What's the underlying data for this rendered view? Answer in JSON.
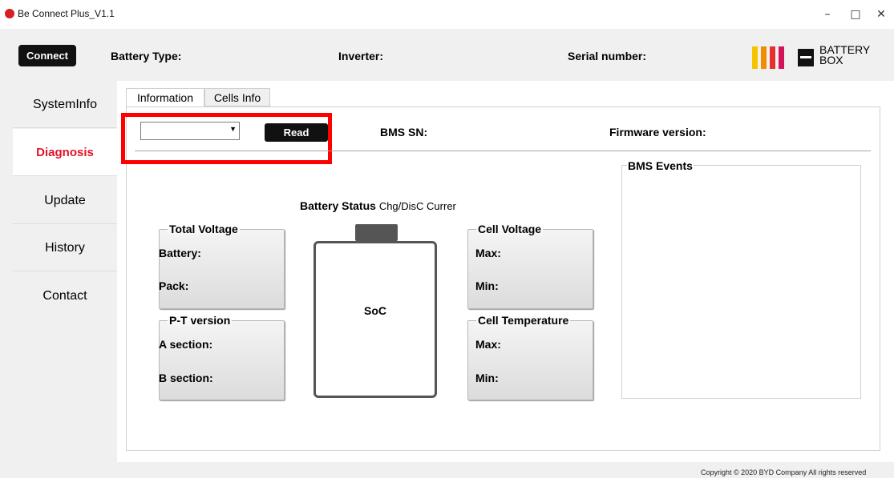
{
  "window": {
    "title": "Be Connect Plus_V1.1",
    "minimize": "–",
    "maximize": "□",
    "close": "✕"
  },
  "header": {
    "connect_label": "Connect",
    "battery_type_label": "Battery Type:",
    "inverter_label": "Inverter:",
    "serial_label": "Serial number:",
    "logo_text_line1": "BATTERY",
    "logo_text_line2": "BOX",
    "logo_colors": [
      "#f5c400",
      "#f28c00",
      "#e4312b",
      "#d4145a"
    ]
  },
  "sidebar": {
    "items": [
      {
        "label": "SystemInfo",
        "active": false
      },
      {
        "label": "Diagnosis",
        "active": true
      },
      {
        "label": "Update",
        "active": false
      },
      {
        "label": "History",
        "active": false
      },
      {
        "label": "Contact",
        "active": false
      }
    ],
    "active_color": "#e3122a"
  },
  "tabs": [
    {
      "label": "Information",
      "active": true
    },
    {
      "label": "Cells Info",
      "active": false
    }
  ],
  "info": {
    "select_value": "",
    "read_label": "Read",
    "bms_sn_label": "BMS SN:",
    "firmware_label": "Firmware version:",
    "bms_events_label": "BMS Events",
    "battery_status_label": "Battery Status",
    "chg_label": "Chg/DisC Currer",
    "soc_label": "SoC"
  },
  "cards": {
    "total_voltage": {
      "title": "Total Voltage",
      "row1": "Battery:",
      "row2": "Pack:"
    },
    "pt_version": {
      "title": "P-T version",
      "row1": "A section:",
      "row2": "B section:"
    },
    "cell_voltage": {
      "title": "Cell Voltage",
      "row1": "Max:",
      "row2": "Min:"
    },
    "cell_temperature": {
      "title": "Cell Temperature",
      "row1": "Max:",
      "row2": "Min:"
    }
  },
  "footer": {
    "copyright": "Copyright © 2020 BYD Company All rights reserved"
  }
}
